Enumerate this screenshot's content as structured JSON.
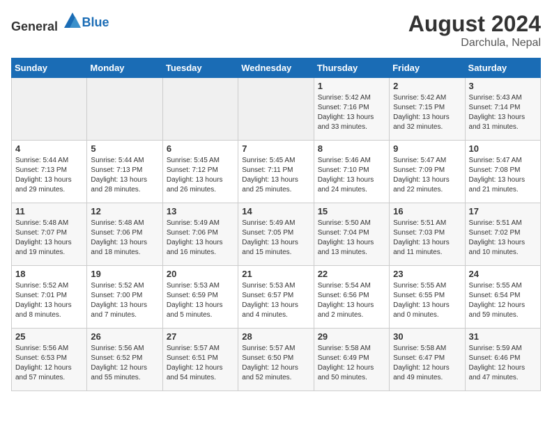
{
  "header": {
    "logo_general": "General",
    "logo_blue": "Blue",
    "title": "August 2024",
    "subtitle": "Darchula, Nepal"
  },
  "calendar": {
    "days_of_week": [
      "Sunday",
      "Monday",
      "Tuesday",
      "Wednesday",
      "Thursday",
      "Friday",
      "Saturday"
    ],
    "weeks": [
      [
        {
          "day": "",
          "info": ""
        },
        {
          "day": "",
          "info": ""
        },
        {
          "day": "",
          "info": ""
        },
        {
          "day": "",
          "info": ""
        },
        {
          "day": "1",
          "info": "Sunrise: 5:42 AM\nSunset: 7:16 PM\nDaylight: 13 hours\nand 33 minutes."
        },
        {
          "day": "2",
          "info": "Sunrise: 5:42 AM\nSunset: 7:15 PM\nDaylight: 13 hours\nand 32 minutes."
        },
        {
          "day": "3",
          "info": "Sunrise: 5:43 AM\nSunset: 7:14 PM\nDaylight: 13 hours\nand 31 minutes."
        }
      ],
      [
        {
          "day": "4",
          "info": "Sunrise: 5:44 AM\nSunset: 7:13 PM\nDaylight: 13 hours\nand 29 minutes."
        },
        {
          "day": "5",
          "info": "Sunrise: 5:44 AM\nSunset: 7:13 PM\nDaylight: 13 hours\nand 28 minutes."
        },
        {
          "day": "6",
          "info": "Sunrise: 5:45 AM\nSunset: 7:12 PM\nDaylight: 13 hours\nand 26 minutes."
        },
        {
          "day": "7",
          "info": "Sunrise: 5:45 AM\nSunset: 7:11 PM\nDaylight: 13 hours\nand 25 minutes."
        },
        {
          "day": "8",
          "info": "Sunrise: 5:46 AM\nSunset: 7:10 PM\nDaylight: 13 hours\nand 24 minutes."
        },
        {
          "day": "9",
          "info": "Sunrise: 5:47 AM\nSunset: 7:09 PM\nDaylight: 13 hours\nand 22 minutes."
        },
        {
          "day": "10",
          "info": "Sunrise: 5:47 AM\nSunset: 7:08 PM\nDaylight: 13 hours\nand 21 minutes."
        }
      ],
      [
        {
          "day": "11",
          "info": "Sunrise: 5:48 AM\nSunset: 7:07 PM\nDaylight: 13 hours\nand 19 minutes."
        },
        {
          "day": "12",
          "info": "Sunrise: 5:48 AM\nSunset: 7:06 PM\nDaylight: 13 hours\nand 18 minutes."
        },
        {
          "day": "13",
          "info": "Sunrise: 5:49 AM\nSunset: 7:06 PM\nDaylight: 13 hours\nand 16 minutes."
        },
        {
          "day": "14",
          "info": "Sunrise: 5:49 AM\nSunset: 7:05 PM\nDaylight: 13 hours\nand 15 minutes."
        },
        {
          "day": "15",
          "info": "Sunrise: 5:50 AM\nSunset: 7:04 PM\nDaylight: 13 hours\nand 13 minutes."
        },
        {
          "day": "16",
          "info": "Sunrise: 5:51 AM\nSunset: 7:03 PM\nDaylight: 13 hours\nand 11 minutes."
        },
        {
          "day": "17",
          "info": "Sunrise: 5:51 AM\nSunset: 7:02 PM\nDaylight: 13 hours\nand 10 minutes."
        }
      ],
      [
        {
          "day": "18",
          "info": "Sunrise: 5:52 AM\nSunset: 7:01 PM\nDaylight: 13 hours\nand 8 minutes."
        },
        {
          "day": "19",
          "info": "Sunrise: 5:52 AM\nSunset: 7:00 PM\nDaylight: 13 hours\nand 7 minutes."
        },
        {
          "day": "20",
          "info": "Sunrise: 5:53 AM\nSunset: 6:59 PM\nDaylight: 13 hours\nand 5 minutes."
        },
        {
          "day": "21",
          "info": "Sunrise: 5:53 AM\nSunset: 6:57 PM\nDaylight: 13 hours\nand 4 minutes."
        },
        {
          "day": "22",
          "info": "Sunrise: 5:54 AM\nSunset: 6:56 PM\nDaylight: 13 hours\nand 2 minutes."
        },
        {
          "day": "23",
          "info": "Sunrise: 5:55 AM\nSunset: 6:55 PM\nDaylight: 13 hours\nand 0 minutes."
        },
        {
          "day": "24",
          "info": "Sunrise: 5:55 AM\nSunset: 6:54 PM\nDaylight: 12 hours\nand 59 minutes."
        }
      ],
      [
        {
          "day": "25",
          "info": "Sunrise: 5:56 AM\nSunset: 6:53 PM\nDaylight: 12 hours\nand 57 minutes."
        },
        {
          "day": "26",
          "info": "Sunrise: 5:56 AM\nSunset: 6:52 PM\nDaylight: 12 hours\nand 55 minutes."
        },
        {
          "day": "27",
          "info": "Sunrise: 5:57 AM\nSunset: 6:51 PM\nDaylight: 12 hours\nand 54 minutes."
        },
        {
          "day": "28",
          "info": "Sunrise: 5:57 AM\nSunset: 6:50 PM\nDaylight: 12 hours\nand 52 minutes."
        },
        {
          "day": "29",
          "info": "Sunrise: 5:58 AM\nSunset: 6:49 PM\nDaylight: 12 hours\nand 50 minutes."
        },
        {
          "day": "30",
          "info": "Sunrise: 5:58 AM\nSunset: 6:47 PM\nDaylight: 12 hours\nand 49 minutes."
        },
        {
          "day": "31",
          "info": "Sunrise: 5:59 AM\nSunset: 6:46 PM\nDaylight: 12 hours\nand 47 minutes."
        }
      ]
    ]
  }
}
